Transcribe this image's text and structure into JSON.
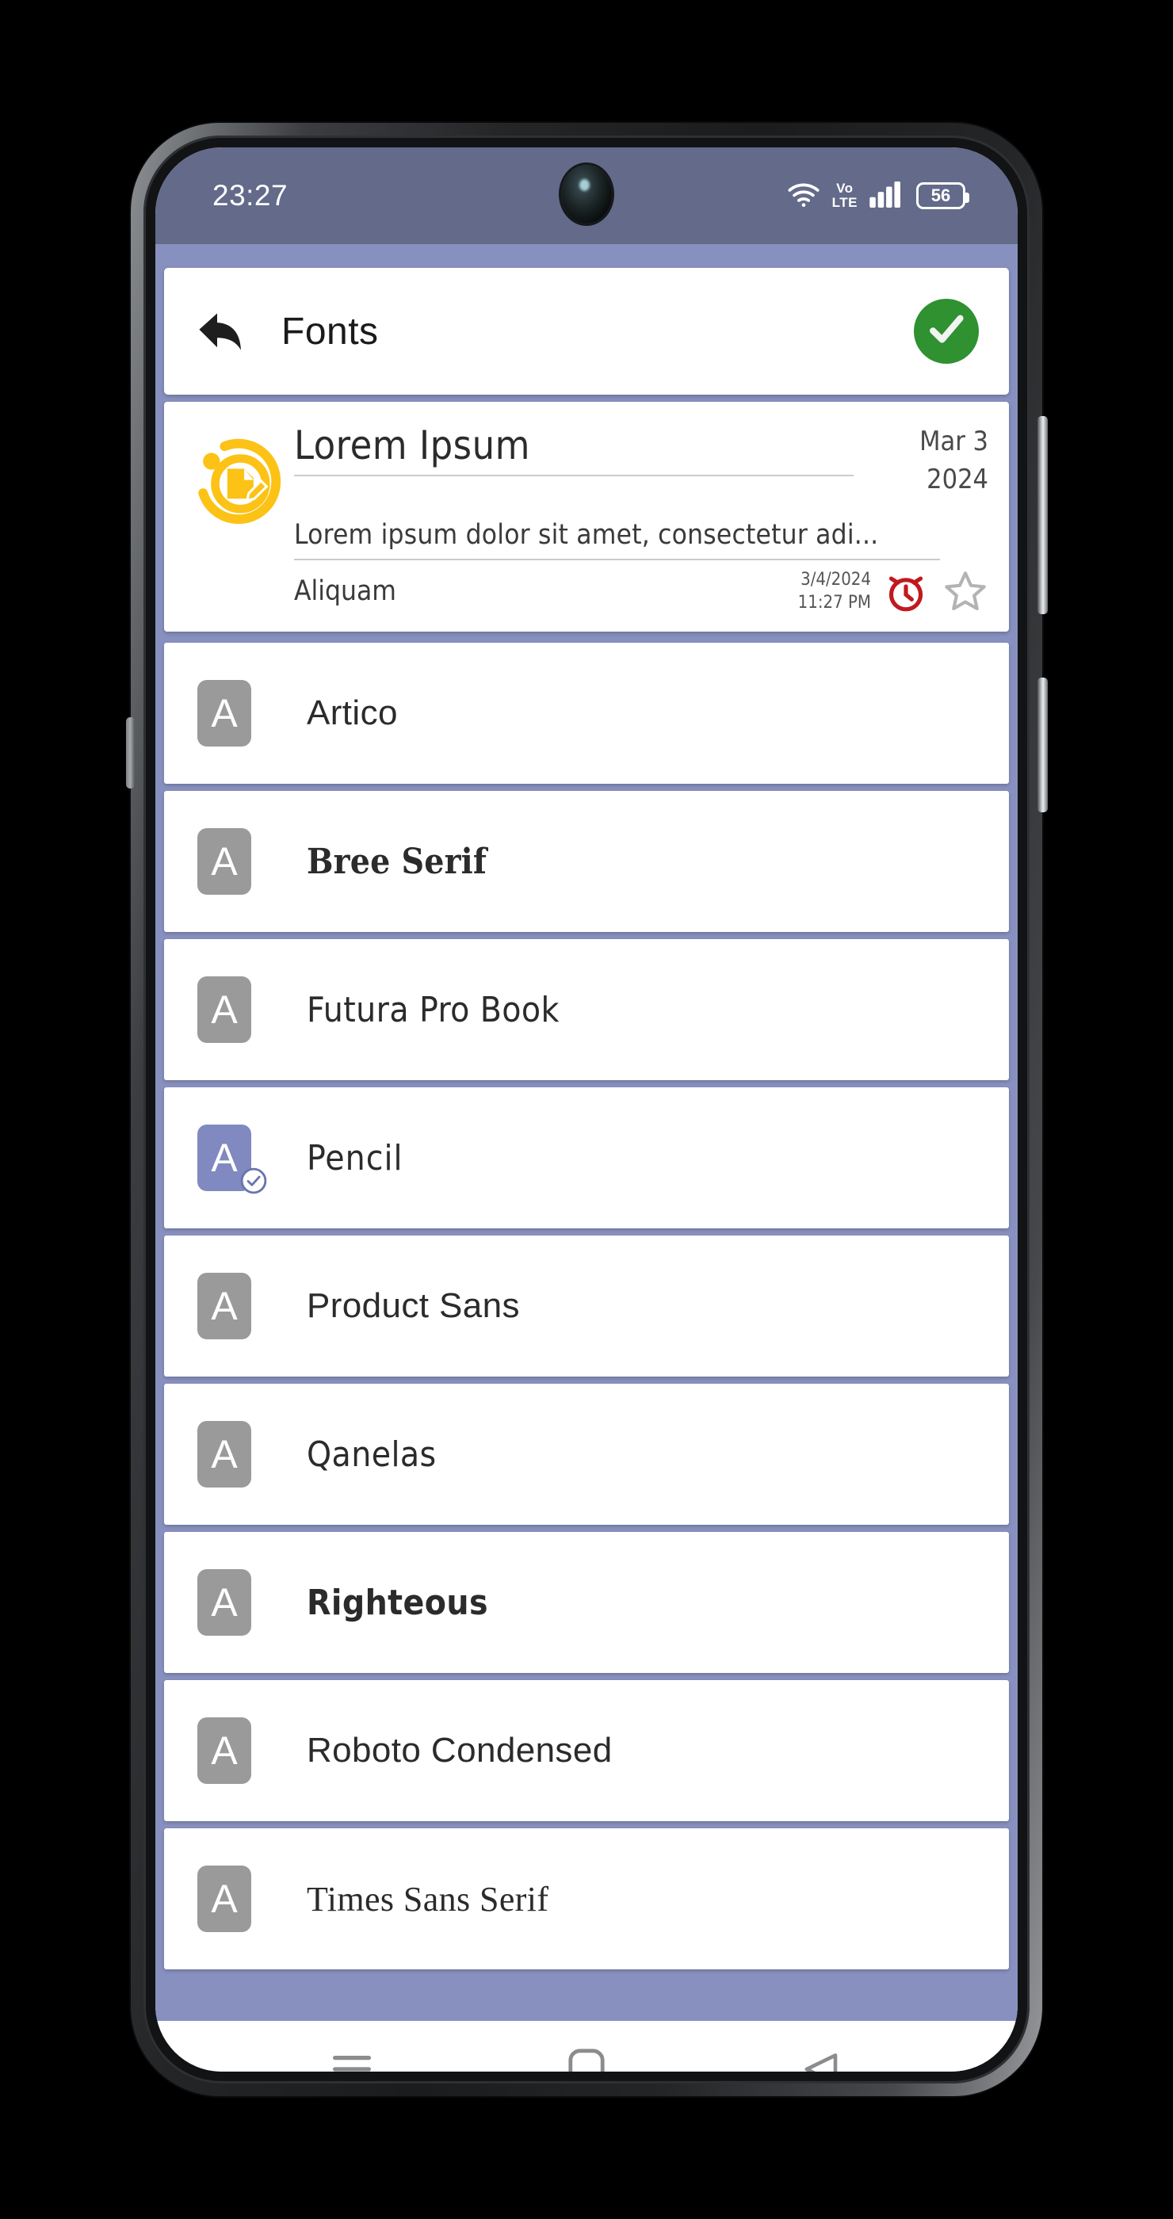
{
  "device": {
    "statusbar": {
      "time": "23:27",
      "wifi_icon": "wifi-icon",
      "volte_line1": "Vo",
      "volte_line2": "LTE",
      "signal_icon": "cellular-signal-icon",
      "battery_level": "56"
    },
    "navbar": {
      "recents_icon": "menu-icon",
      "home_icon": "home-square-icon",
      "back_icon": "back-triangle-icon"
    },
    "camera_icon": "front-camera-icon"
  },
  "app": {
    "appbar": {
      "back_icon": "back-arrow-icon",
      "title": "Fonts",
      "confirm_icon": "check-circle-icon"
    },
    "preview_note": {
      "logo_icon": "note-app-logo-icon",
      "title": "Lorem Ipsum",
      "date_line1": "Mar 3",
      "date_line2": "2024",
      "snippet": "Lorem ipsum dolor sit amet, consectetur adi...",
      "tag": "Aliquam",
      "stamp_date": "3/4/2024",
      "stamp_time": "11:27 PM",
      "alarm_icon": "alarm-clock-icon",
      "star_icon": "star-outline-icon"
    },
    "font_list": {
      "badge_letter": "A",
      "items": [
        {
          "name": "Artico",
          "class": "f-artico",
          "selected": false
        },
        {
          "name": "Bree Serif",
          "class": "f-bree",
          "selected": false
        },
        {
          "name": "Futura Pro Book",
          "class": "f-futura",
          "selected": false
        },
        {
          "name": "Pencil",
          "class": "f-pencil",
          "selected": true
        },
        {
          "name": "Product Sans",
          "class": "f-product",
          "selected": false
        },
        {
          "name": "Qanelas",
          "class": "f-qanelas",
          "selected": false
        },
        {
          "name": "Righteous",
          "class": "f-righteous",
          "selected": false
        },
        {
          "name": "Roboto Condensed",
          "class": "f-roboto",
          "selected": false
        },
        {
          "name": "Times Sans Serif",
          "class": "f-times",
          "selected": false
        }
      ]
    }
  },
  "colors": {
    "statusbar_bg": "#646a89",
    "app_bg": "#8790bf",
    "card_bg": "#ffffff",
    "confirm_green": "#2f9130",
    "logo_yellow": "#fcc215",
    "alarm_red": "#c0191f",
    "badge_gray": "#9a9a9a",
    "badge_selected": "#8089c0",
    "star_gray": "#b3b3b3"
  }
}
